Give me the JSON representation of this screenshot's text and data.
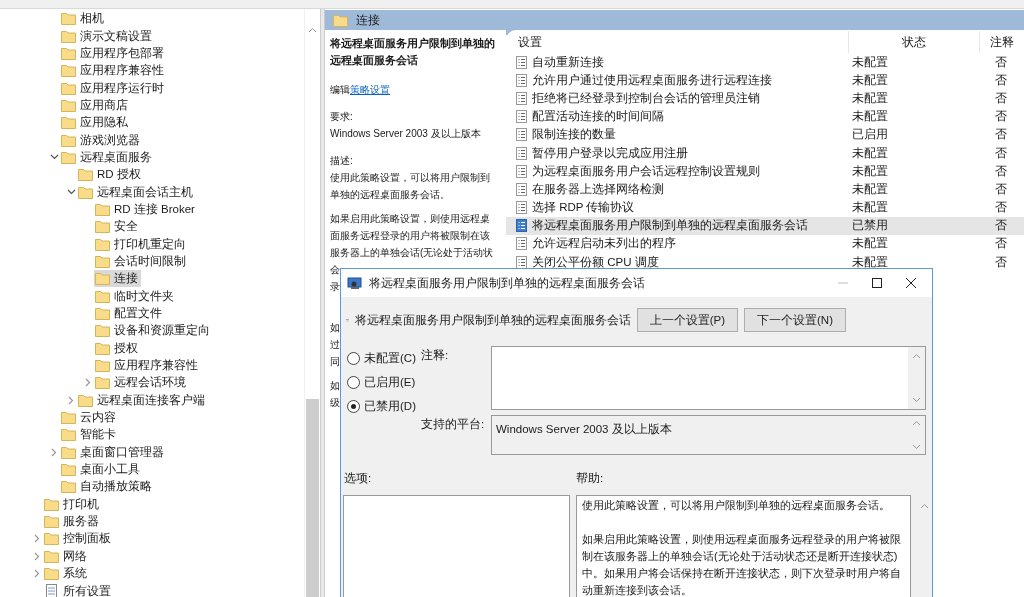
{
  "tree": {
    "items": [
      {
        "children": [
          {
            "label": "相机",
            "kind": "folder"
          },
          {
            "label": "演示文稿设置",
            "kind": "folder"
          },
          {
            "label": "应用程序包部署",
            "kind": "folder"
          },
          {
            "label": "应用程序兼容性",
            "kind": "folder"
          },
          {
            "label": "应用程序运行时",
            "kind": "folder"
          },
          {
            "label": "应用商店",
            "kind": "folder"
          },
          {
            "label": "应用隐私",
            "kind": "folder"
          },
          {
            "label": "游戏浏览器",
            "kind": "folder"
          },
          {
            "label": "远程桌面服务",
            "kind": "folder",
            "expanded": true,
            "children": [
              {
                "label": "RD 授权",
                "kind": "folder"
              },
              {
                "label": "远程桌面会话主机",
                "kind": "folder",
                "expanded": true,
                "children": [
                  {
                    "label": "RD 连接 Broker",
                    "kind": "folder",
                    "selected": false
                  },
                  {
                    "label": "安全",
                    "kind": "folder",
                    "selected": false
                  },
                  {
                    "label": "打印机重定向",
                    "kind": "folder",
                    "selected": false
                  },
                  {
                    "label": "会话时间限制",
                    "kind": "folder",
                    "selected": false
                  },
                  {
                    "label": "连接",
                    "kind": "folder",
                    "selected": true
                  },
                  {
                    "label": "临时文件夹",
                    "kind": "folder",
                    "selected": false
                  },
                  {
                    "label": "配置文件",
                    "kind": "folder",
                    "selected": false
                  },
                  {
                    "label": "设备和资源重定向",
                    "kind": "folder",
                    "selected": false
                  },
                  {
                    "label": "授权",
                    "kind": "folder",
                    "selected": false
                  },
                  {
                    "label": "应用程序兼容性",
                    "kind": "folder",
                    "selected": false
                  },
                  {
                    "label": "远程会话环境",
                    "kind": "folder",
                    "expanded": false,
                    "selected": false
                  }
                ]
              },
              {
                "label": "远程桌面连接客户端",
                "kind": "folder",
                "expanded": false
              }
            ]
          },
          {
            "label": "云内容",
            "kind": "folder"
          },
          {
            "label": "智能卡",
            "kind": "folder"
          },
          {
            "label": "桌面窗口管理器",
            "kind": "folder",
            "expanded": false
          },
          {
            "label": "桌面小工具",
            "kind": "folder"
          },
          {
            "label": "自动播放策略",
            "kind": "folder"
          }
        ]
      },
      {
        "label": "打印机",
        "kind": "folder"
      },
      {
        "label": "服务器",
        "kind": "folder"
      },
      {
        "label": "控制面板",
        "kind": "folder",
        "expanded": false
      },
      {
        "label": "网络",
        "kind": "folder",
        "expanded": false
      },
      {
        "label": "系统",
        "kind": "folder",
        "expanded": false
      },
      {
        "label": "所有设置",
        "kind": "settings"
      }
    ]
  },
  "header": {
    "title": "连接"
  },
  "description": {
    "title": "将远程桌面服务用户限制到单独的远程桌面服务会话",
    "edit_prefix": "编辑",
    "edit_link": "策略设置",
    "requirement_label": "要求:",
    "requirement": "Windows Server 2003 及以上版本",
    "description_label": "描述:",
    "paragraphs": [
      [
        "使用此策略设置，可以将用户限制到",
        "单独的远程桌面服务会话。"
      ],
      [
        "如果启用此策略设置，则使用远程桌",
        "面服务远程登录的用户将被限制在该",
        "服务器上的单独会话(无论处于活动状",
        "会",
        "录"
      ],
      [
        "如",
        "过",
        "同"
      ],
      [
        "如",
        "级"
      ]
    ]
  },
  "table": {
    "columns": [
      "设置",
      "状态",
      "注释"
    ],
    "rows": [
      {
        "name": "自动重新连接",
        "state": "未配置",
        "comment": "否",
        "selected": false
      },
      {
        "name": "允许用户通过使用远程桌面服务进行远程连接",
        "state": "未配置",
        "comment": "否",
        "selected": false
      },
      {
        "name": "拒绝将已经登录到控制台会话的管理员注销",
        "state": "未配置",
        "comment": "否",
        "selected": false
      },
      {
        "name": "配置活动连接的时间间隔",
        "state": "未配置",
        "comment": "否",
        "selected": false
      },
      {
        "name": "限制连接的数量",
        "state": "已启用",
        "comment": "否",
        "selected": false
      },
      {
        "name": "暂停用户登录以完成应用注册",
        "state": "未配置",
        "comment": "否",
        "selected": false
      },
      {
        "name": "为远程桌面服务用户会话远程控制设置规则",
        "state": "未配置",
        "comment": "否",
        "selected": false
      },
      {
        "name": "在服务器上选择网络检测",
        "state": "未配置",
        "comment": "否",
        "selected": false
      },
      {
        "name": "选择 RDP 传输协议",
        "state": "未配置",
        "comment": "否",
        "selected": false
      },
      {
        "name": "将远程桌面服务用户限制到单独的远程桌面服务会话",
        "state": "已禁用",
        "comment": "否",
        "selected": true
      },
      {
        "name": "允许远程启动未列出的程序",
        "state": "未配置",
        "comment": "否",
        "selected": false
      },
      {
        "name": "关闭公平份额 CPU 调度",
        "state": "未配置",
        "comment": "否",
        "selected": false
      }
    ]
  },
  "dialog": {
    "title": "将远程桌面服务用户限制到单独的远程桌面服务会话",
    "policy_title": "将远程桌面服务用户限制到单独的远程桌面服务会话",
    "buttons": [
      "上一个设置(P)",
      "下一个设置(N)"
    ],
    "options": [
      {
        "label": "未配置(C)",
        "selected": false
      },
      {
        "label": "已启用(E)",
        "selected": false
      },
      {
        "label": "已禁用(D)",
        "selected": true
      }
    ],
    "comment_label": "注释:",
    "platform_label": "支持的平台:",
    "platform": "Windows Server 2003 及以上版本",
    "options_label": "选项:",
    "help_label": "帮助:",
    "help": [
      "使用此策略设置，可以将用户限制到单独的远程桌面服务会话。",
      "如果启用此策略设置，则使用远程桌面服务远程登录的用户将被限制在该服务器上的单独会话(无论处于活动状态还是断开连接状态)中。如果用户将会话保持在断开连接状态，则下次登录时用户将自动重新连接到该会话。"
    ]
  }
}
